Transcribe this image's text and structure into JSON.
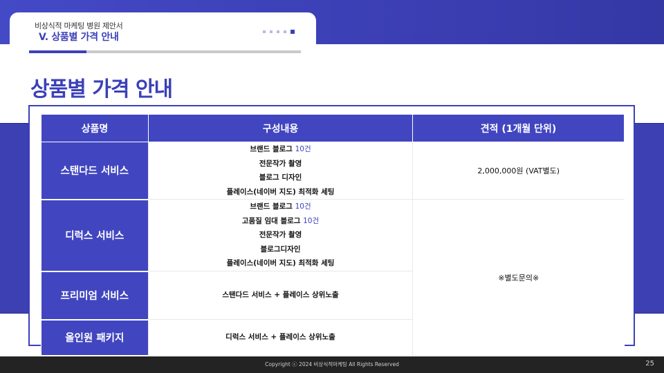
{
  "header": {
    "subtitle": "비상식적 마케팅 병원 제안서",
    "section_title": "V. 상품별 가격 안내",
    "nav_dots_total": 5,
    "nav_dots_active_index": 4,
    "progress_fraction": 0.21
  },
  "page_title": "상품별 가격 안내",
  "table": {
    "headers": [
      "상품명",
      "구성내용",
      "견적 (1개월 단위)"
    ],
    "rows": [
      {
        "name": "스탠다드 서비스",
        "composition": [
          {
            "text": "브랜드 블로그 ",
            "highlight": "10건"
          },
          {
            "text": "전문작가 촬영",
            "highlight": ""
          },
          {
            "text": "블로그 디자인",
            "highlight": ""
          },
          {
            "text": "플레이스(네이버 지도) 최적화 세팅",
            "highlight": ""
          }
        ],
        "price": "2,000,000원 (VAT별도)"
      },
      {
        "name": "디럭스 서비스",
        "composition": [
          {
            "text": "브랜드 블로그 ",
            "highlight": "10건"
          },
          {
            "text": "고품질 임대 블로그 ",
            "highlight": "10건"
          },
          {
            "text": "전문작가 촬영",
            "highlight": ""
          },
          {
            "text": "블로그디자인",
            "highlight": ""
          },
          {
            "text": "플레이스(네이버 지도) 최적화 세팅",
            "highlight": ""
          }
        ],
        "price": "※별도문의※"
      },
      {
        "name": "프리미엄 서비스",
        "composition": [
          {
            "text": "스탠다드 서비스 + 플레이스 상위노출",
            "highlight": ""
          }
        ]
      },
      {
        "name": "올인원 패키지",
        "composition": [
          {
            "text": "디럭스 서비스 + 플레이스 상위노출",
            "highlight": ""
          }
        ]
      }
    ]
  },
  "footer": {
    "copyright": "Copyright ⓒ 2024 비상식적마케팅 All Rights Reserved",
    "page_number": "25"
  },
  "colors": {
    "brand": "#3b40b8",
    "table_header": "#4146c0",
    "footer": "#232323"
  }
}
